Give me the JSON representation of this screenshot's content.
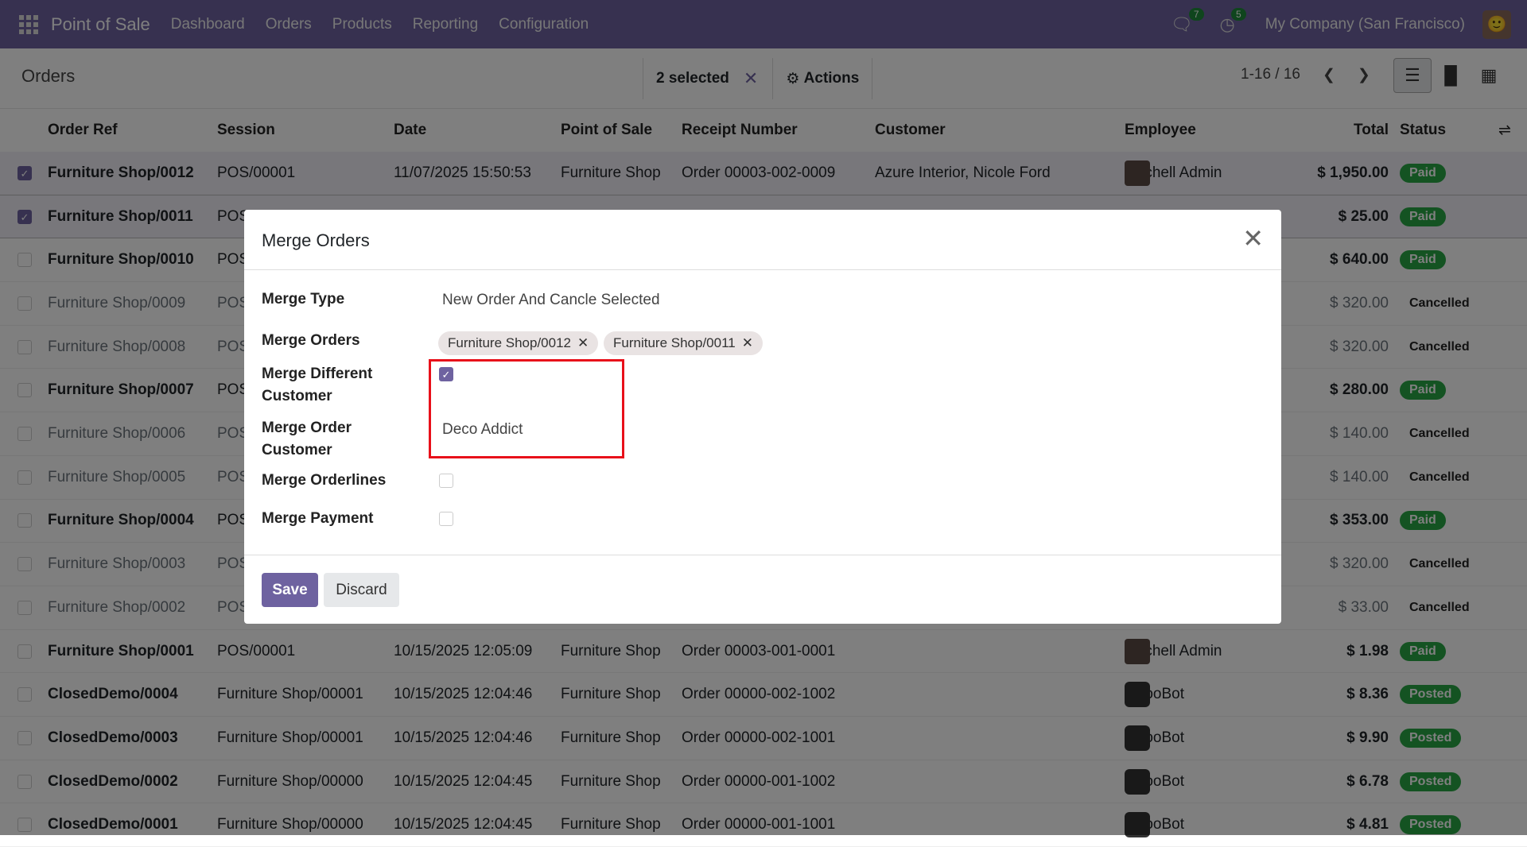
{
  "navbar": {
    "app": "Point of Sale",
    "menus": [
      "Dashboard",
      "Orders",
      "Products",
      "Reporting",
      "Configuration"
    ],
    "messages_count": "7",
    "activities_count": "5",
    "company": "My Company (San Francisco)"
  },
  "control": {
    "title": "Orders",
    "selected": "2 selected",
    "actions": "Actions",
    "pager": "1-16 / 16"
  },
  "table": {
    "headers": {
      "ref": "Order Ref",
      "session": "Session",
      "date": "Date",
      "pos": "Point of Sale",
      "receipt": "Receipt Number",
      "customer": "Customer",
      "employee": "Employee",
      "total": "Total",
      "status": "Status"
    },
    "rows": [
      {
        "ref": "Furniture Shop/0012",
        "session": "POS/00001",
        "date": "11/07/2025 15:50:53",
        "pos": "Furniture Shop",
        "receipt": "Order 00003-002-0009",
        "customer": "Azure Interior, Nicole Ford",
        "employee": "Mitchell Admin",
        "total": "$ 1,950.00",
        "status": "Paid"
      },
      {
        "ref": "Furniture Shop/0011",
        "session": "POS",
        "date": "",
        "pos": "",
        "receipt": "",
        "customer": "",
        "employee": "",
        "total": "$ 25.00",
        "status": "Paid"
      },
      {
        "ref": "Furniture Shop/0010",
        "session": "POS",
        "date": "",
        "pos": "",
        "receipt": "",
        "customer": "",
        "employee": "",
        "total": "$ 640.00",
        "status": "Paid"
      },
      {
        "ref": "Furniture Shop/0009",
        "session": "POS",
        "date": "",
        "pos": "",
        "receipt": "",
        "customer": "",
        "employee": "",
        "total": "$ 320.00",
        "status": "Cancelled"
      },
      {
        "ref": "Furniture Shop/0008",
        "session": "POS",
        "date": "",
        "pos": "",
        "receipt": "",
        "customer": "",
        "employee": "",
        "total": "$ 320.00",
        "status": "Cancelled"
      },
      {
        "ref": "Furniture Shop/0007",
        "session": "POS",
        "date": "",
        "pos": "",
        "receipt": "",
        "customer": "",
        "employee": "",
        "total": "$ 280.00",
        "status": "Paid"
      },
      {
        "ref": "Furniture Shop/0006",
        "session": "POS",
        "date": "",
        "pos": "",
        "receipt": "",
        "customer": "",
        "employee": "",
        "total": "$ 140.00",
        "status": "Cancelled"
      },
      {
        "ref": "Furniture Shop/0005",
        "session": "POS",
        "date": "",
        "pos": "",
        "receipt": "",
        "customer": "",
        "employee": "",
        "total": "$ 140.00",
        "status": "Cancelled"
      },
      {
        "ref": "Furniture Shop/0004",
        "session": "POS",
        "date": "",
        "pos": "",
        "receipt": "",
        "customer": "",
        "employee": "",
        "total": "$ 353.00",
        "status": "Paid"
      },
      {
        "ref": "Furniture Shop/0003",
        "session": "POS",
        "date": "",
        "pos": "",
        "receipt": "",
        "customer": "",
        "employee": "",
        "total": "$ 320.00",
        "status": "Cancelled"
      },
      {
        "ref": "Furniture Shop/0002",
        "session": "POS",
        "date": "",
        "pos": "",
        "receipt": "",
        "customer": "",
        "employee": "",
        "total": "$ 33.00",
        "status": "Cancelled"
      },
      {
        "ref": "Furniture Shop/0001",
        "session": "POS/00001",
        "date": "10/15/2025 12:05:09",
        "pos": "Furniture Shop",
        "receipt": "Order 00003-001-0001",
        "customer": "",
        "employee": "Mitchell Admin",
        "total": "$ 1.98",
        "status": "Paid"
      },
      {
        "ref": "ClosedDemo/0004",
        "session": "Furniture Shop/00001",
        "date": "10/15/2025 12:04:46",
        "pos": "Furniture Shop",
        "receipt": "Order 00000-002-1002",
        "customer": "",
        "employee": "OdooBot",
        "total": "$ 8.36",
        "status": "Posted"
      },
      {
        "ref": "ClosedDemo/0003",
        "session": "Furniture Shop/00001",
        "date": "10/15/2025 12:04:46",
        "pos": "Furniture Shop",
        "receipt": "Order 00000-002-1001",
        "customer": "",
        "employee": "OdooBot",
        "total": "$ 9.90",
        "status": "Posted"
      },
      {
        "ref": "ClosedDemo/0002",
        "session": "Furniture Shop/00000",
        "date": "10/15/2025 12:04:45",
        "pos": "Furniture Shop",
        "receipt": "Order 00000-001-1002",
        "customer": "",
        "employee": "OdooBot",
        "total": "$ 6.78",
        "status": "Posted"
      },
      {
        "ref": "ClosedDemo/0001",
        "session": "Furniture Shop/00000",
        "date": "10/15/2025 12:04:45",
        "pos": "Furniture Shop",
        "receipt": "Order 00000-001-1001",
        "customer": "",
        "employee": "OdooBot",
        "total": "$ 4.81",
        "status": "Posted"
      }
    ]
  },
  "modal": {
    "title": "Merge Orders",
    "merge_type_label": "Merge Type",
    "merge_type": "New Order And Cancle Selected",
    "merge_orders_label": "Merge Orders",
    "merge_orders": [
      "Furniture Shop/0012",
      "Furniture Shop/0011"
    ],
    "diff_customer_label_1": "Merge Different",
    "diff_customer_label_2": "Customer",
    "diff_customer_checked": true,
    "order_customer_label_1": "Merge Order",
    "order_customer_label_2": "Customer",
    "order_customer": "Deco Addict",
    "orderlines_label": "Merge Orderlines",
    "orderlines_checked": false,
    "payment_label": "Merge Payment",
    "payment_checked": false,
    "save": "Save",
    "discard": "Discard"
  },
  "colors": {
    "brand": "#6e62a0",
    "paid": "#28a745",
    "highlight": "#e8101a"
  }
}
